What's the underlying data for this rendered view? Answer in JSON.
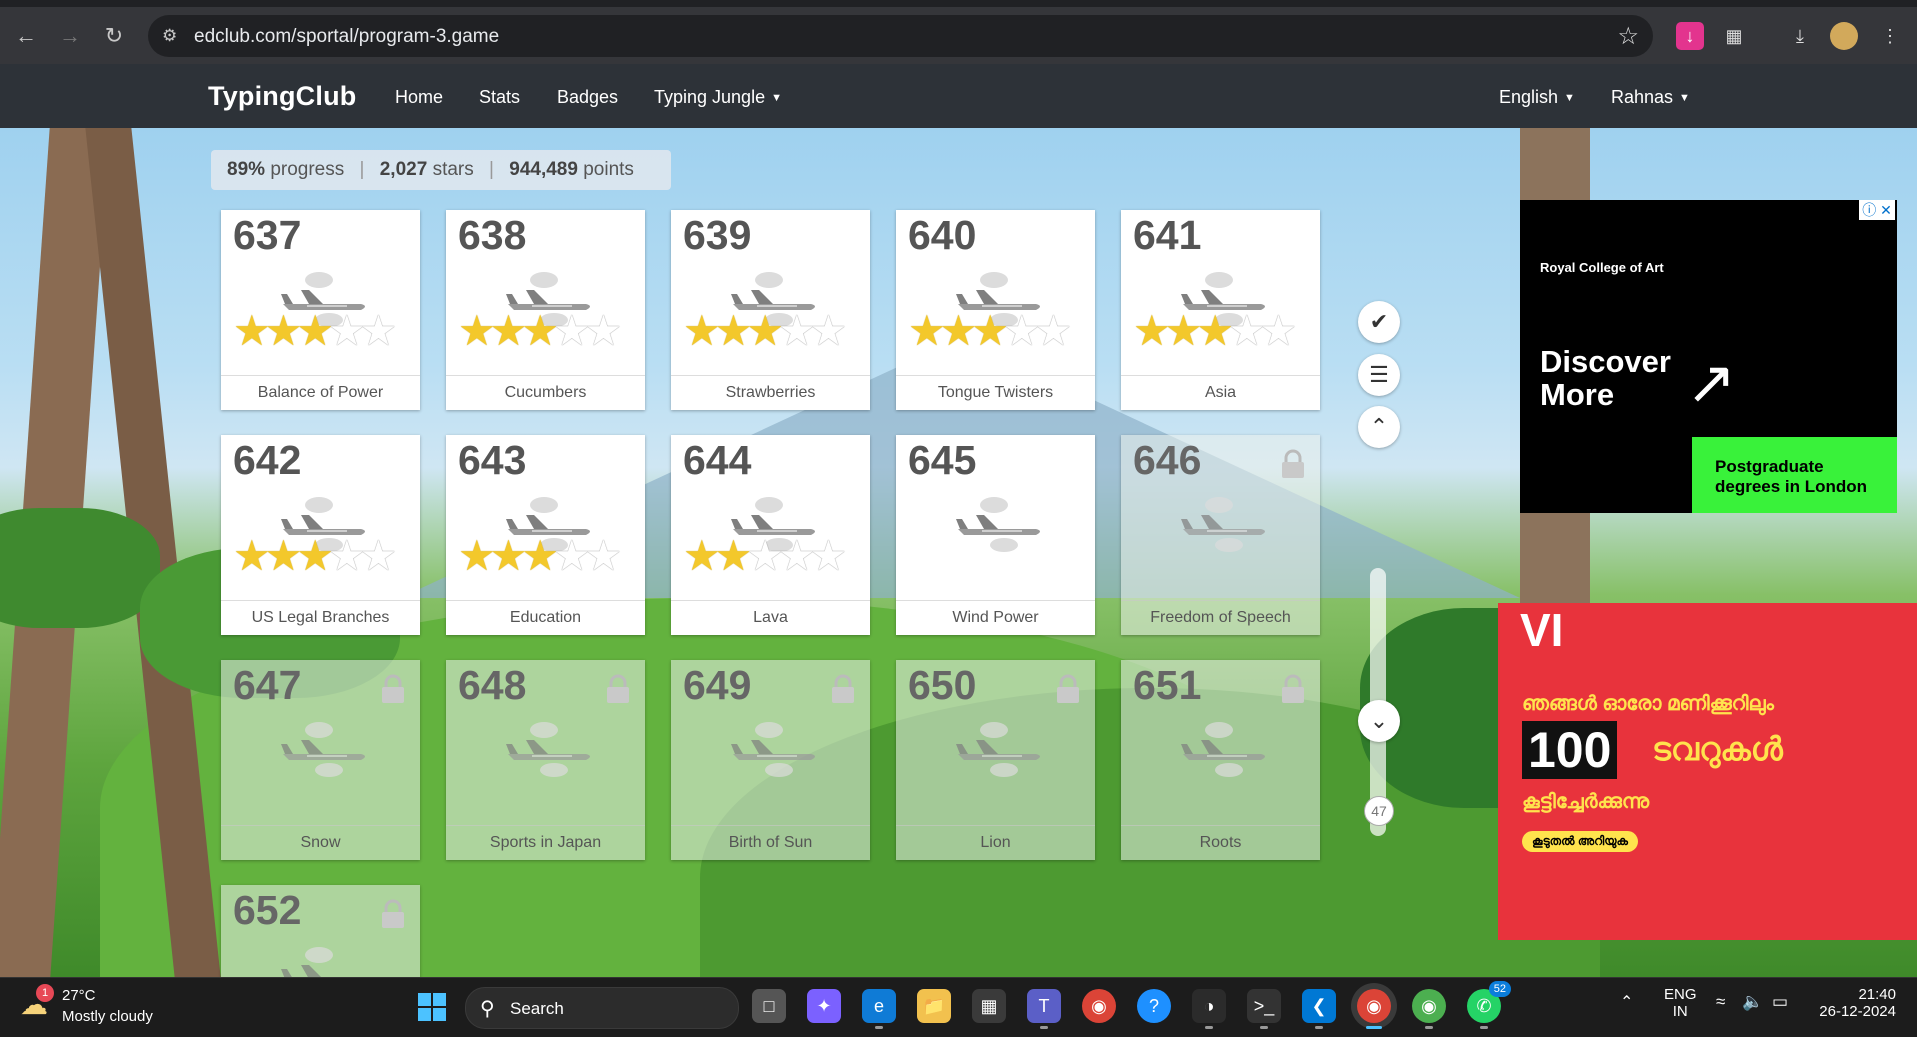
{
  "browser": {
    "url": "edclub.com/sportal/program-3.game"
  },
  "navbar": {
    "brand": "TypingClub",
    "links": [
      "Home",
      "Stats",
      "Badges",
      "Typing Jungle"
    ],
    "language": "English",
    "user": "Rahnas"
  },
  "stats": {
    "progress_value": "89%",
    "progress_label": "progress",
    "stars_value": "2,027",
    "stars_label": "stars",
    "points_value": "944,489",
    "points_label": "points"
  },
  "lessons": [
    {
      "num": "637",
      "name": "Balance of Power",
      "stars": 3,
      "locked": false
    },
    {
      "num": "638",
      "name": "Cucumbers",
      "stars": 3,
      "locked": false
    },
    {
      "num": "639",
      "name": "Strawberries",
      "stars": 3,
      "locked": false
    },
    {
      "num": "640",
      "name": "Tongue Twisters",
      "stars": 3,
      "locked": false
    },
    {
      "num": "641",
      "name": "Asia",
      "stars": 3,
      "locked": false
    },
    {
      "num": "642",
      "name": "US Legal Branches",
      "stars": 3,
      "locked": false
    },
    {
      "num": "643",
      "name": "Education",
      "stars": 3,
      "locked": false
    },
    {
      "num": "644",
      "name": "Lava",
      "stars": 2,
      "locked": false
    },
    {
      "num": "645",
      "name": "Wind Power",
      "stars": 0,
      "locked": false
    },
    {
      "num": "646",
      "name": "Freedom of Speech",
      "stars": 0,
      "locked": true
    },
    {
      "num": "647",
      "name": "Snow",
      "stars": 0,
      "locked": true
    },
    {
      "num": "648",
      "name": "Sports in Japan",
      "stars": 0,
      "locked": true
    },
    {
      "num": "649",
      "name": "Birth of Sun",
      "stars": 0,
      "locked": true
    },
    {
      "num": "650",
      "name": "Lion",
      "stars": 0,
      "locked": true
    },
    {
      "num": "651",
      "name": "Roots",
      "stars": 0,
      "locked": true
    },
    {
      "num": "652",
      "name": "",
      "stars": 0,
      "locked": true
    }
  ],
  "sidebar": {
    "scroll_position": "47"
  },
  "ads": {
    "ad1": {
      "logo": "Royal College of Art",
      "headline_1": "Discover",
      "headline_2": "More",
      "sub_1": "Postgraduate",
      "sub_2": "degrees in London"
    },
    "ad2": {
      "logo": "VI",
      "line1": "ഞങ്ങൾ ഓരോ മണിക്കൂറിലും",
      "big_number": "100",
      "line2_word": "ടവറുകൾ",
      "line3": "കൂട്ടിച്ചേർക്കുന്നു",
      "cta": "കൂടുതൽ അറിയുക"
    }
  },
  "taskbar": {
    "weather_badge": "1",
    "temperature": "27°C",
    "condition": "Mostly cloudy",
    "search_label": "Search",
    "whatsapp_badge": "52",
    "lang_1": "ENG",
    "lang_2": "IN",
    "time": "21:40",
    "date": "26-12-2024"
  }
}
